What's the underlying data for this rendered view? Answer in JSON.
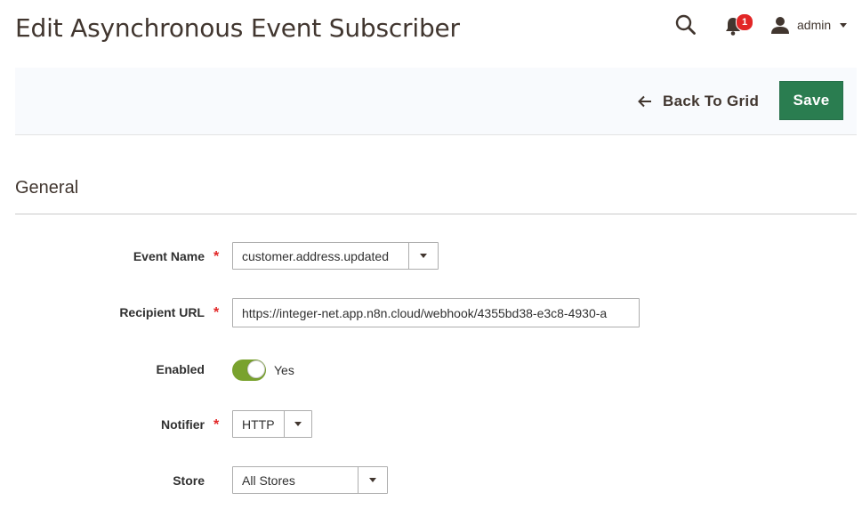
{
  "header": {
    "title": "Edit Asynchronous Event Subscriber",
    "notification_count": "1",
    "user_name": "admin",
    "icons": {
      "search": "search-icon",
      "notifications": "bell-icon",
      "user": "user-icon"
    }
  },
  "action_bar": {
    "back_label": "Back To Grid",
    "save_label": "Save",
    "save_color": "#2a7d50"
  },
  "section": {
    "title": "General"
  },
  "form": {
    "event_name": {
      "label": "Event Name",
      "required_mark": "*",
      "value": "customer.address.updated"
    },
    "recipient_url": {
      "label": "Recipient URL",
      "required_mark": "*",
      "value": "https://integer-net.app.n8n.cloud/webhook/4355bd38-e3c8-4930-a"
    },
    "enabled": {
      "label": "Enabled",
      "value": "Yes",
      "toggle_color": "#79a22e"
    },
    "notifier": {
      "label": "Notifier",
      "required_mark": "*",
      "value": "HTTP"
    },
    "store": {
      "label": "Store",
      "value": "All Stores"
    }
  }
}
